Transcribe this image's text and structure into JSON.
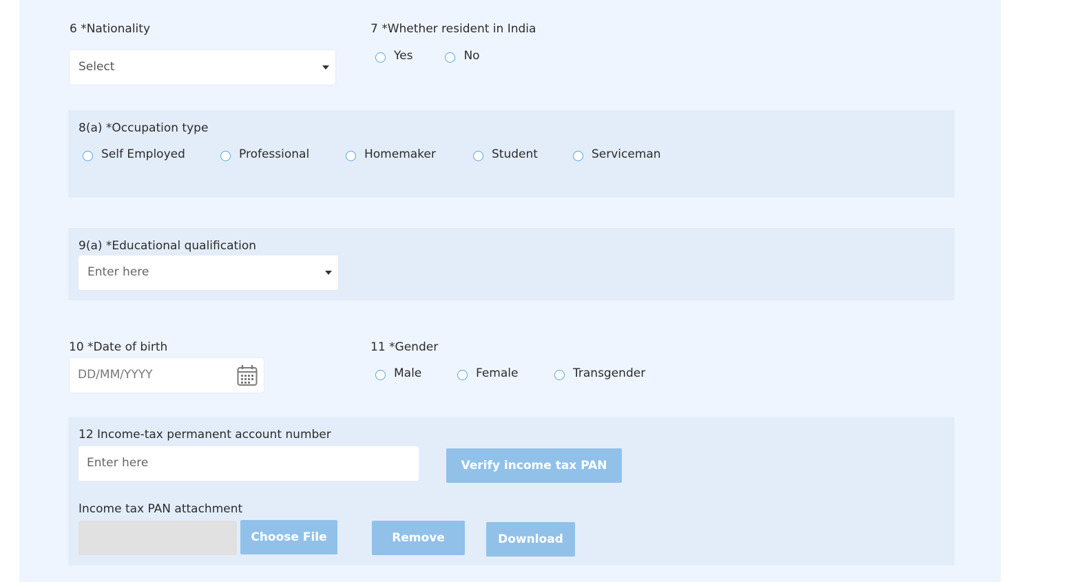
{
  "nationality": {
    "label": "6 *Nationality",
    "selected": "Select"
  },
  "resident": {
    "label": "7 *Whether resident in India",
    "options": [
      "Yes",
      "No"
    ]
  },
  "occupation": {
    "label": "8(a) *Occupation type",
    "options": [
      "Self Employed",
      "Professional",
      "Homemaker",
      "Student",
      "Serviceman"
    ]
  },
  "education": {
    "label": "9(a) *Educational qualification",
    "placeholder": "Enter here"
  },
  "dob": {
    "label": "10 *Date of birth",
    "placeholder": "DD/MM/YYYY",
    "icon": "calendar-icon"
  },
  "gender": {
    "label": "11 *Gender",
    "options": [
      "Male",
      "Female",
      "Transgender"
    ]
  },
  "pan": {
    "label": "12 Income-tax permanent account number",
    "placeholder": "Enter here",
    "verify_label": "Verify income tax PAN",
    "attachment_label": "Income tax PAN attachment",
    "choose_label": "Choose File",
    "remove_label": "Remove",
    "download_label": "Download"
  },
  "colors": {
    "panel_bg": "#eef5fe",
    "section_bg": "#e3edf9",
    "button_bg": "#91c1e9",
    "radio_border": "#55a6e6"
  }
}
